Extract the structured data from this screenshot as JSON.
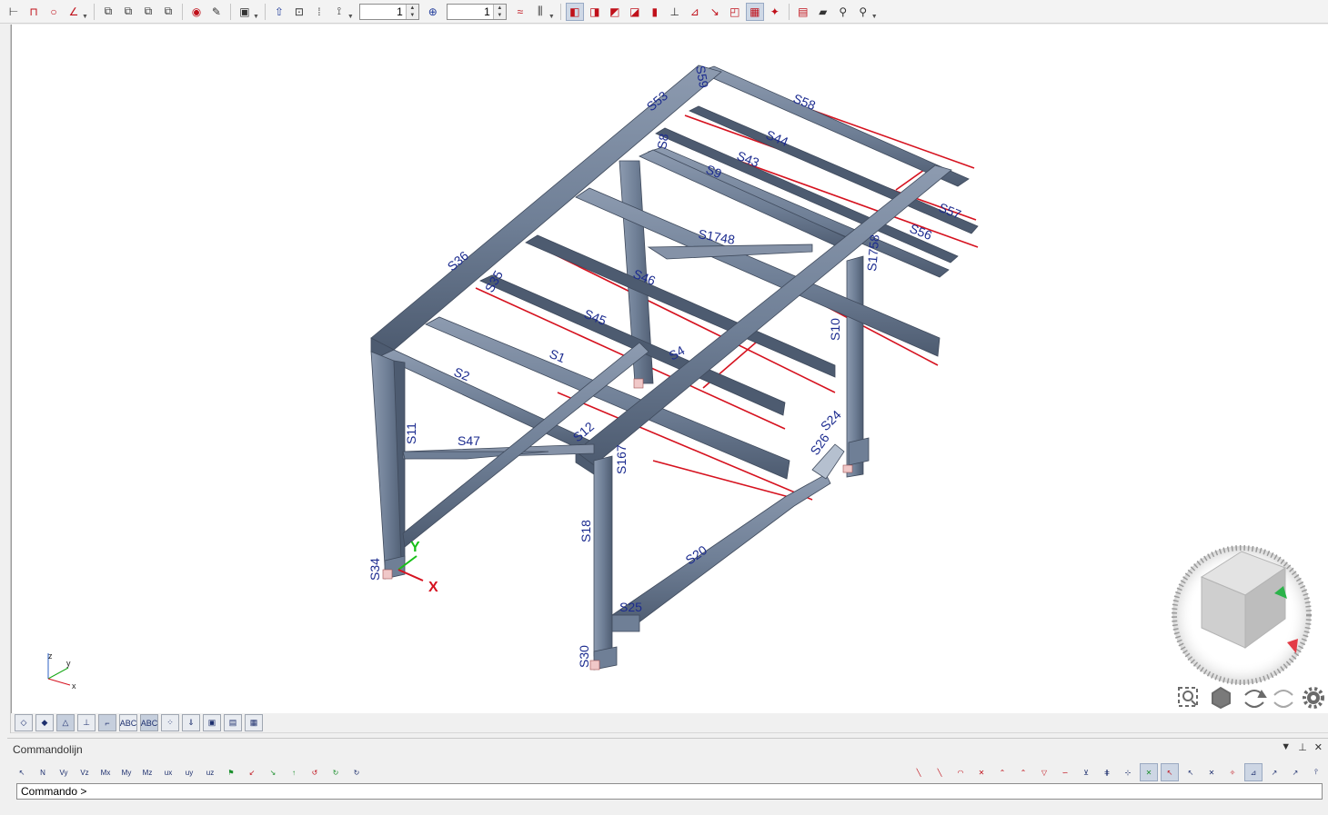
{
  "toolbar": {
    "spinner1_value": "1",
    "spinner2_value": "1",
    "buttons_group1": [
      "ruler-icon",
      "frame-icon",
      "circle-icon",
      "angle-icon"
    ],
    "buttons_group2": [
      "copy-icon",
      "copy-array-icon",
      "copy-plane-icon",
      "copy-stack-icon"
    ],
    "buttons_group3": [
      "eye-icon",
      "pencil-icon"
    ],
    "buttons_group4": [
      "import-icon"
    ],
    "buttons_group5": [
      "arrow-up-icon",
      "zoom-sheet-icon",
      "grid-icon",
      "dimension-icon"
    ]
  },
  "viewport": {
    "member_labels": [
      "S58",
      "S53",
      "S44",
      "S43",
      "S9",
      "S57",
      "S56",
      "S1748",
      "S1758",
      "S46",
      "S45",
      "S4",
      "S1",
      "S2",
      "S47",
      "S11",
      "S12",
      "S167",
      "S24",
      "S26",
      "S18",
      "S20",
      "S25",
      "S34",
      "S30",
      "S10",
      "S35",
      "S36",
      "S59",
      "S8"
    ],
    "axis_labels": {
      "x": "X",
      "y": "Y",
      "z": "Z",
      "mini_x": "x",
      "mini_y": "y",
      "mini_z": "z"
    },
    "colors": {
      "steel": "#6f7f96",
      "steel_dark": "#4d5b70",
      "steel_light": "#8d9bb0",
      "load_line": "#d6121f",
      "label": "#1b2b8f"
    }
  },
  "nav": {
    "buttons": [
      "zoom-extents-icon",
      "view-cube-icon",
      "orbit-icon",
      "pan-icon",
      "settings-icon"
    ]
  },
  "view_tools": {
    "buttons": [
      "shade-icon",
      "render-icon",
      "supports-icon",
      "loads-icon",
      "local-axes-icon",
      "labels-icon",
      "labels-alt-icon",
      "mesh-icon",
      "results-icon",
      "report-icon",
      "table-icon",
      "grid-display-icon"
    ]
  },
  "command": {
    "title": "Commandolijn",
    "prompt": "Commando >",
    "buttons": [
      "N",
      "Vy",
      "Vz",
      "Mx",
      "My",
      "Mz",
      "ux",
      "uy",
      "uz"
    ]
  }
}
